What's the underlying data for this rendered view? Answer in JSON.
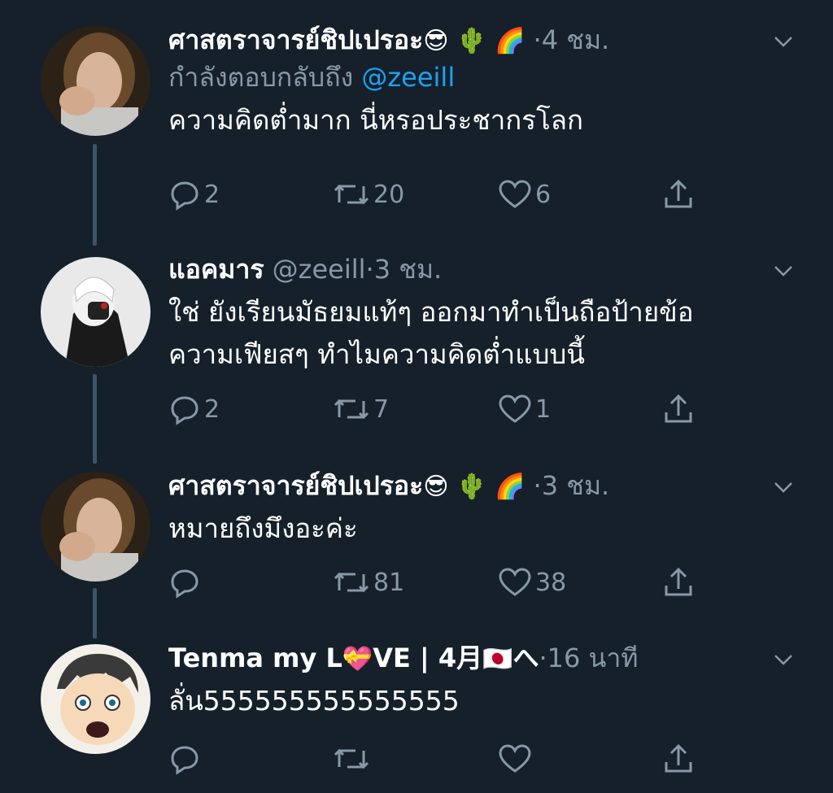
{
  "tweets": [
    {
      "name": "ศาสตราจารย์ชิปเปรอะ",
      "name_emojis": "😎 🌵 🌈",
      "handle": "",
      "time": "4 ชม.",
      "reply_prefix": "กำลังตอบกลับถึง",
      "reply_mention": "@zeeill",
      "text_lines": [
        "ความคิดต่ำมาก นี่หรอประชากรโลก"
      ],
      "replies": "2",
      "retweets": "20",
      "likes": "6",
      "avatar": "man-portrait-avatar"
    },
    {
      "name": "แอคมาร",
      "name_emojis": "",
      "handle": "@zeeill",
      "time": "3 ชม.",
      "text_lines": [
        "ใช่ ยังเรียนมัธยมแท้ๆ ออกมาทำเป็นถือป้ายข้อ",
        "ความเฟียสๆ ทำไมความคิดต่ำแบบนี้"
      ],
      "replies": "2",
      "retweets": "7",
      "likes": "1",
      "avatar": "anime-masked-avatar"
    },
    {
      "name": "ศาสตราจารย์ชิปเปรอะ",
      "name_emojis": "😎 🌵 🌈",
      "handle": "",
      "time": "3 ชม.",
      "text_lines": [
        "หมายถึงมึงอะค่ะ"
      ],
      "replies": "",
      "retweets": "81",
      "likes": "38",
      "avatar": "man-portrait-avatar"
    },
    {
      "name": "Tenma my L",
      "name_emojis": "💝",
      "name_suffix": "VE | 4月",
      "flag": "🇯🇵",
      "name_tail": "へ",
      "handle": "",
      "time": "16 นาที",
      "text_lines": [
        "ลั่น555555555555555"
      ],
      "replies": "",
      "retweets": "",
      "likes": "",
      "avatar": "cartoon-boy-avatar"
    }
  ],
  "separator": "·",
  "colors": {
    "background": "#15202b",
    "muted": "#8899a6",
    "accent": "#1da1f2",
    "thread_line": "#3d5466"
  }
}
